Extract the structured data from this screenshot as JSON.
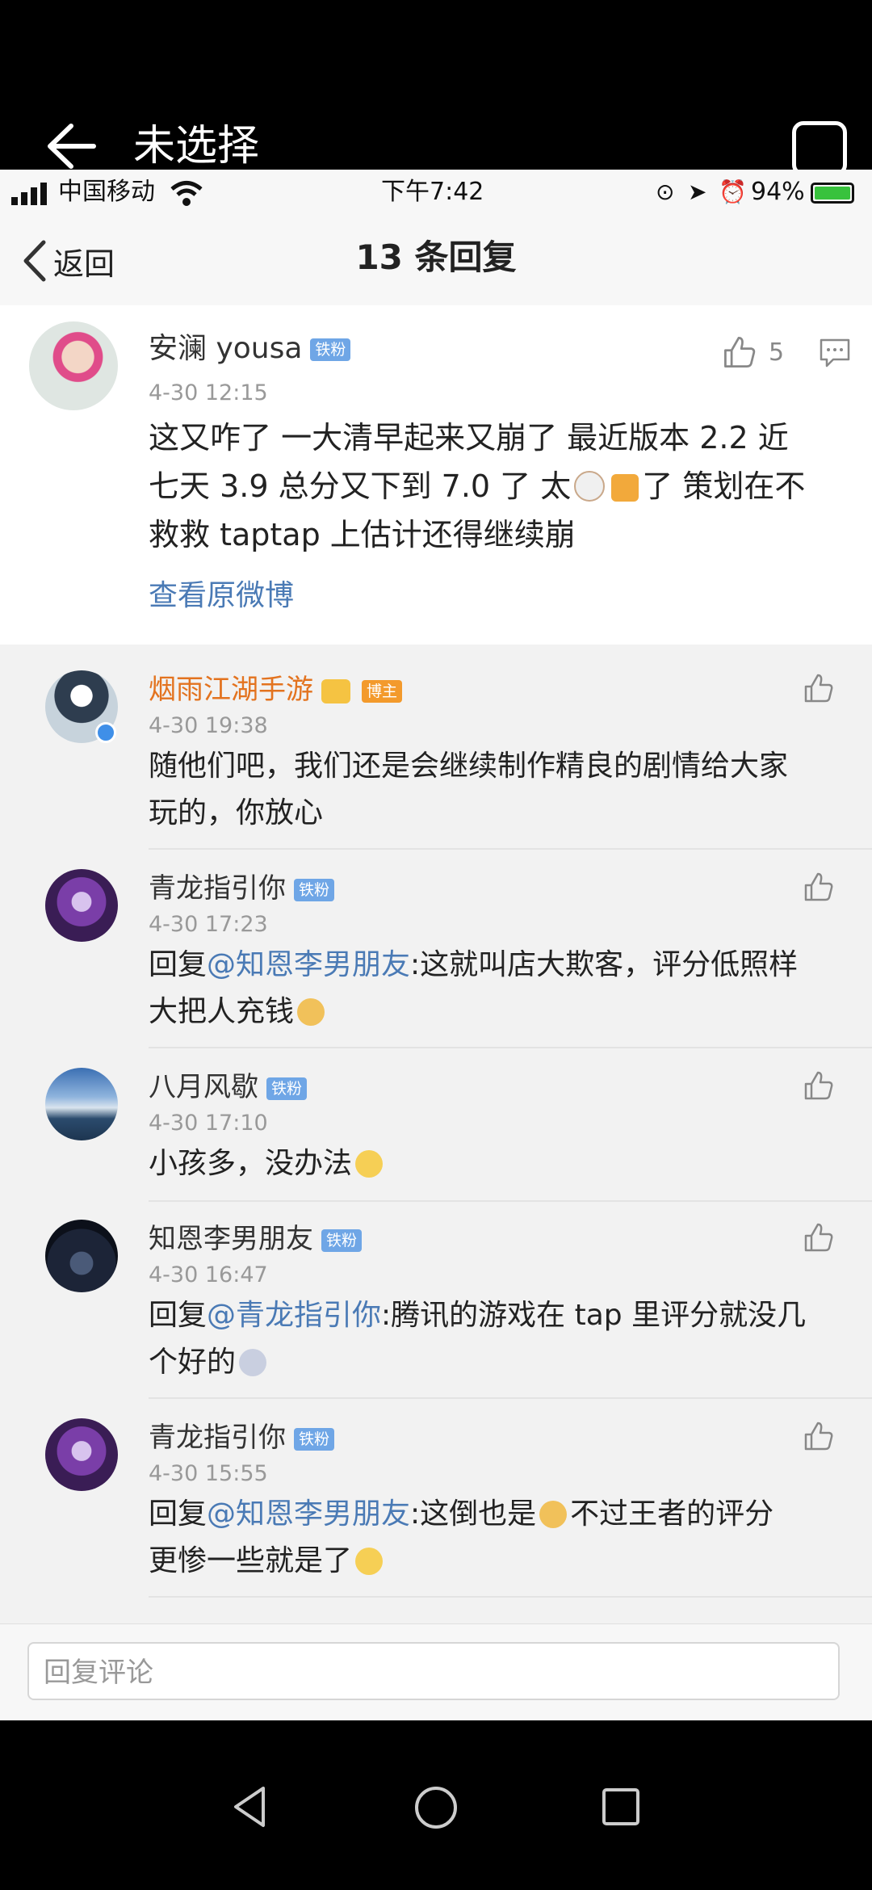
{
  "topbar": {
    "title": "未选择"
  },
  "statusbar": {
    "carrier": "中国移动",
    "time": "下午7:42",
    "battery": "94%"
  },
  "nav": {
    "back_label": "返回",
    "title": "13 条回复"
  },
  "post": {
    "username": "安澜 yousa",
    "badge": "铁粉",
    "time": "4-30 12:15",
    "like_count": "5",
    "text_line1": "这又咋了  一大清早起来又崩了 最近版本 2.2  近",
    "text_line2a": "七天 3.9 总分又下到 7.0 了 太",
    "text_line2b": "了 策划在不",
    "text_line3": "救救  taptap 上估计还得继续崩",
    "view_original": "查看原微博"
  },
  "replies": [
    {
      "username": "烟雨江湖手游",
      "badge": "博主",
      "time": "4-30 19:38",
      "line1": "随他们吧，我们还是会继续制作精良的剧情给大家",
      "line2": "玩的，你放心"
    },
    {
      "username": "青龙指引你",
      "badge": "铁粉",
      "time": "4-30 17:23",
      "prefix": "回复",
      "mention": "@知恩李男朋友",
      "line1_rest": ":这就叫店大欺客，评分低照样",
      "line2": "大把人充钱"
    },
    {
      "username": "八月风歇",
      "badge": "铁粉",
      "time": "4-30 17:10",
      "line1": "小孩多，没办法"
    },
    {
      "username": "知恩李男朋友",
      "badge": "铁粉",
      "time": "4-30 16:47",
      "prefix": "回复",
      "mention": "@青龙指引你",
      "line1_rest": ":腾讯的游戏在 tap 里评分就没几",
      "line2": "个好的"
    },
    {
      "username": "青龙指引你",
      "badge": "铁粉",
      "time": "4-30 15:55",
      "prefix": "回复",
      "mention": "@知恩李男朋友",
      "line1_rest": ":这倒也是",
      "line1_rest2": "不过王者的评分",
      "line2": "更惨一些就是了"
    }
  ],
  "input": {
    "placeholder": "回复评论"
  },
  "icons": {
    "back": "arrow-left-icon",
    "like": "thumbs-up-icon",
    "comment": "comment-icon",
    "wifi": "wifi-icon",
    "signal": "signal-icon",
    "battery": "battery-icon",
    "nav_back": "triangle-back-icon",
    "nav_home": "circle-home-icon",
    "nav_recent": "square-recent-icon"
  },
  "colors": {
    "link": "#4a7ab5",
    "blogger_name": "#e3731f",
    "badge_blue": "#6fa6e6",
    "badge_orange": "#f39a2c"
  }
}
